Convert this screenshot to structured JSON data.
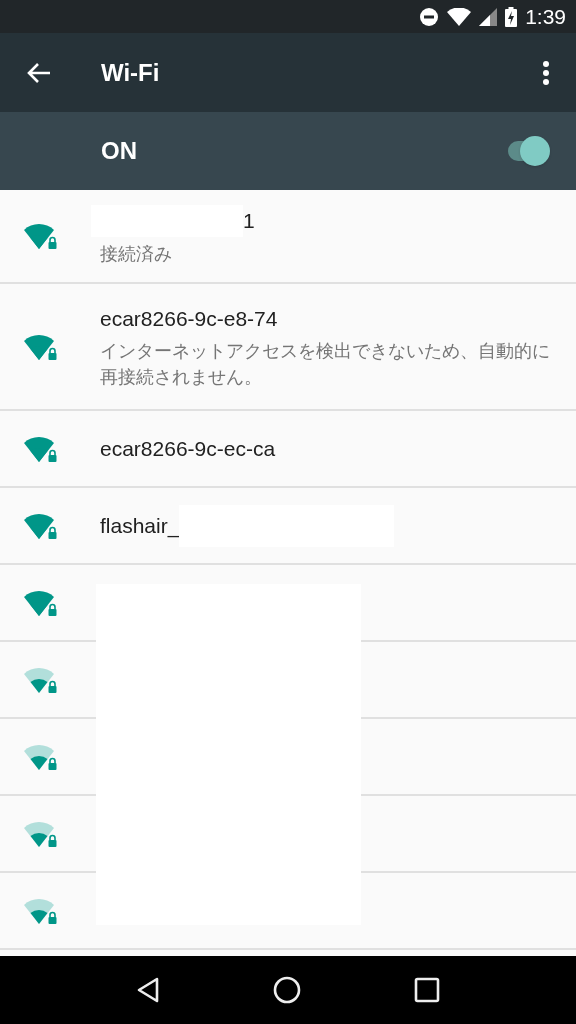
{
  "status_bar": {
    "time": "1:39"
  },
  "app_bar": {
    "title": "Wi-Fi"
  },
  "master_switch": {
    "label": "ON",
    "on": true
  },
  "networks": [
    {
      "name": "1",
      "status": "接続済み",
      "kind": "full",
      "secured": true,
      "prefix_hidden": true,
      "suffix_hidden": false
    },
    {
      "name": "ecar8266-9c-e8-74",
      "status": "インターネットアクセスを検出できないため、自動的に再接続されません。",
      "kind": "full",
      "secured": true,
      "prefix_hidden": false,
      "suffix_hidden": false
    },
    {
      "name": "ecar8266-9c-ec-ca",
      "kind": "full",
      "secured": true,
      "prefix_hidden": false,
      "suffix_hidden": false
    },
    {
      "name": "flashair_",
      "kind": "full",
      "secured": true,
      "prefix_hidden": false,
      "suffix_hidden": true
    },
    {
      "kind": "full",
      "secured": true,
      "prefix_hidden": false,
      "suffix_hidden": false
    },
    {
      "kind": "partial",
      "secured": true,
      "prefix_hidden": false,
      "suffix_hidden": false
    },
    {
      "kind": "partial",
      "secured": true,
      "prefix_hidden": false,
      "suffix_hidden": false
    },
    {
      "kind": "partial",
      "secured": true,
      "prefix_hidden": false,
      "suffix_hidden": false
    },
    {
      "kind": "partial",
      "secured": true,
      "prefix_hidden": false,
      "suffix_hidden": false
    }
  ],
  "list_redacted": true
}
